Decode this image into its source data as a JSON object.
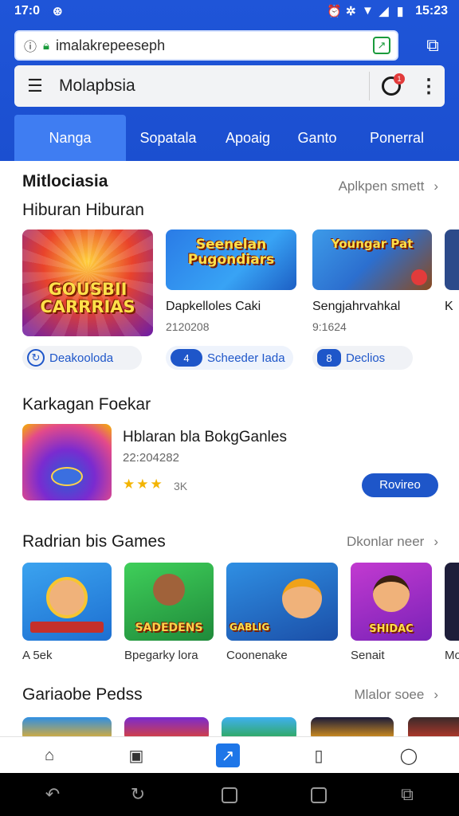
{
  "status_bar": {
    "time": "17:0",
    "clock_right": "15:23"
  },
  "browser": {
    "url": "imalakrepeeseph",
    "search_text": "Molapbsia",
    "notification_count": "1"
  },
  "nav_tabs": [
    {
      "label": "Nanga",
      "active": true
    },
    {
      "label": "Sopatala",
      "active": false
    },
    {
      "label": "Apoaig",
      "active": false
    },
    {
      "label": "Ganto",
      "active": false
    },
    {
      "label": "Ponerral",
      "active": false
    }
  ],
  "section1": {
    "title": "Mitlociasia",
    "link": "Aplkpen smett",
    "subtitle": "Hiburan Hiburan",
    "cards": [
      {
        "art_text": "GOUSBII CARRRIAS",
        "title": "Dapkelloles Caki",
        "sub": "2120208",
        "chip": "Deakooloda",
        "chip_icon": ""
      },
      {
        "art_text": "Seenelan Pugondiars",
        "title": "Sengjahrvahkal",
        "sub": "9:1624",
        "chip": "Scheeder Iada",
        "chip_icon": "4"
      },
      {
        "art_text": "Youngar Pat",
        "title": "Sengjahrvahkal",
        "sub": "9:1624",
        "chip": "Declios",
        "chip_icon": "8"
      }
    ]
  },
  "section2": {
    "title": "Karkagan Foekar",
    "feature": {
      "title": "Hblaran bla BokgGanles",
      "sub": "22:204282",
      "stars": "★★★",
      "rating_count": "3K",
      "button": "Rovireo"
    }
  },
  "section3": {
    "title": "Radrian bis Games",
    "link": "Dkonlar neer",
    "items": [
      {
        "art_text": "",
        "label": "A 5ek"
      },
      {
        "art_text": "SADEDENS",
        "label": "Bpegarky lora"
      },
      {
        "art_text": "GABLIG",
        "label": "Coonenake"
      },
      {
        "art_text": "SHIDAC",
        "label": "Senait"
      },
      {
        "art_text": "",
        "label": "Mo"
      }
    ]
  },
  "section4": {
    "title": "Gariaobe Pedss",
    "link": "Mlalor soee"
  },
  "colors": {
    "brand_blue": "#1f55d8",
    "accent_blue": "#1e56c9",
    "active_tab": "#3f7df2"
  }
}
